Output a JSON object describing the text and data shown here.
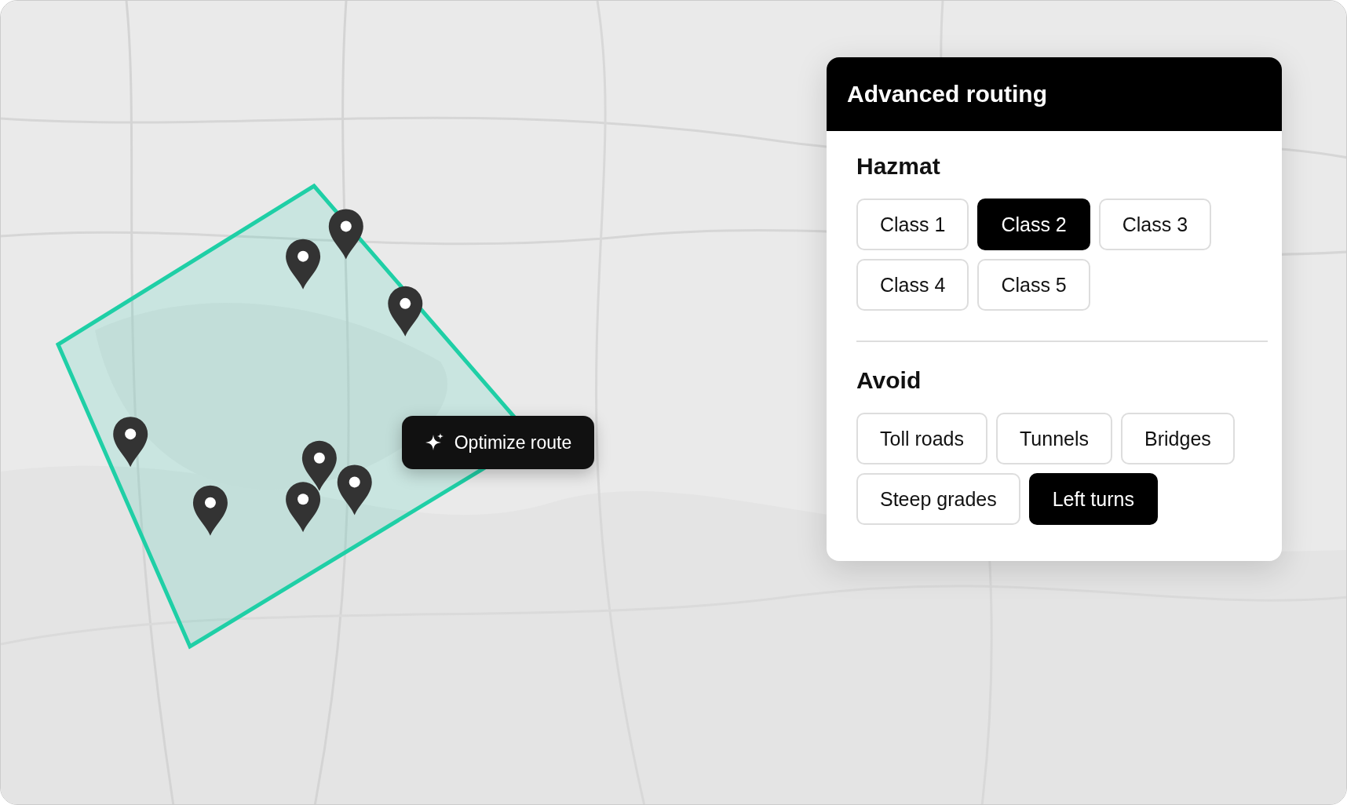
{
  "optimize_button": {
    "label": "Optimize route"
  },
  "panel": {
    "title": "Advanced routing",
    "sections": [
      {
        "heading": "Hazmat",
        "options": [
          {
            "label": "Class 1",
            "selected": false
          },
          {
            "label": "Class 2",
            "selected": true
          },
          {
            "label": "Class 3",
            "selected": false
          },
          {
            "label": "Class 4",
            "selected": false
          },
          {
            "label": "Class 5",
            "selected": false
          }
        ]
      },
      {
        "heading": "Avoid",
        "options": [
          {
            "label": "Toll roads",
            "selected": false
          },
          {
            "label": "Tunnels",
            "selected": false
          },
          {
            "label": "Bridges",
            "selected": false
          },
          {
            "label": "Steep grades",
            "selected": false
          },
          {
            "label": "Left turns",
            "selected": true
          }
        ]
      }
    ]
  }
}
